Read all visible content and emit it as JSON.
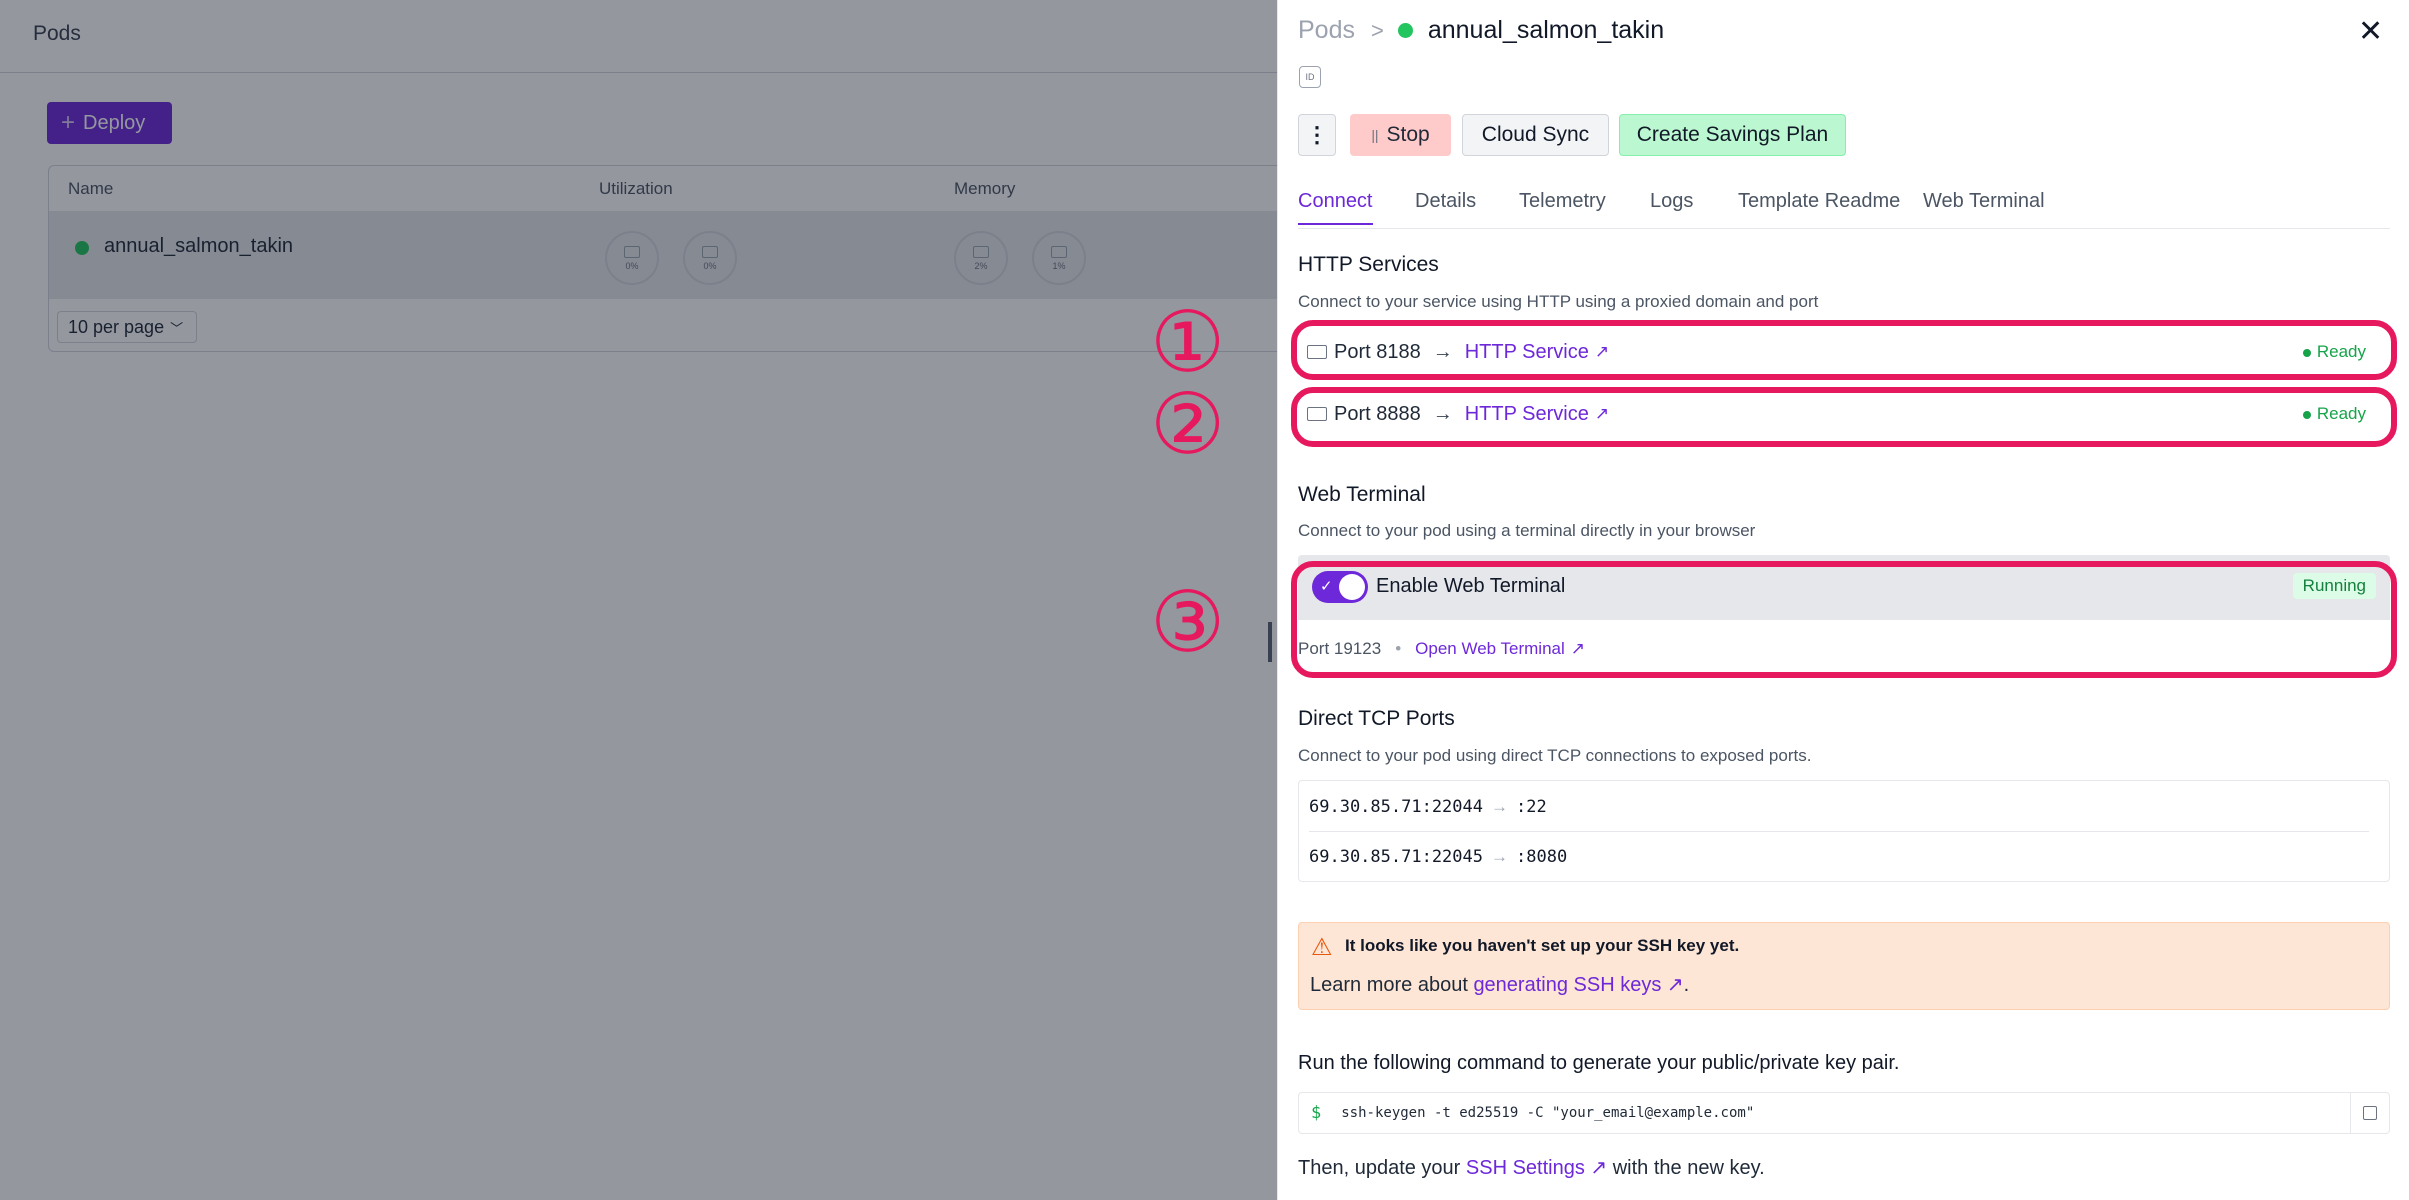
{
  "left": {
    "page_title": "Pods",
    "deploy_label": "Deploy",
    "columns": [
      "Name",
      "Utilization",
      "Memory"
    ],
    "row": {
      "name": "annual_salmon_takin",
      "util": [
        "0%",
        "0%"
      ],
      "mem": [
        "2%",
        "1%"
      ]
    },
    "per_page": "10 per page"
  },
  "panel": {
    "breadcrumb_root": "Pods",
    "breadcrumb_sep": ">",
    "pod_name": "annual_salmon_takin",
    "id_badge": "ID",
    "close": "✕",
    "more": "⋮",
    "stop_label": "Stop",
    "cloud_sync_label": "Cloud Sync",
    "savings_label": "Create Savings Plan",
    "tabs": [
      "Connect",
      "Details",
      "Telemetry",
      "Logs",
      "Template Readme",
      "Web Terminal"
    ],
    "http": {
      "title": "HTTP Services",
      "subtitle": "Connect to your service using HTTP using a proxied domain and port",
      "services": [
        {
          "port": "Port 8188",
          "label": "HTTP Service",
          "status": "Ready"
        },
        {
          "port": "Port 8888",
          "label": "HTTP Service",
          "status": "Ready"
        }
      ]
    },
    "web_terminal": {
      "title": "Web Terminal",
      "subtitle": "Connect to your pod using a terminal directly in your browser",
      "toggle_label": "Enable Web Terminal",
      "status": "Running",
      "port": "Port 19123",
      "open_label": "Open Web Terminal"
    },
    "tcp": {
      "title": "Direct TCP Ports",
      "subtitle": "Connect to your pod using direct TCP connections to exposed ports.",
      "rows": [
        {
          "addr": "69.30.85.71:22044",
          "target": ":22"
        },
        {
          "addr": "69.30.85.71:22045",
          "target": ":8080"
        }
      ]
    },
    "warning": {
      "title": "It looks like you haven't set up your SSH key yet.",
      "prefix": "Learn more about ",
      "link": "generating SSH keys",
      "suffix": "."
    },
    "ssh": {
      "instruction": "Run the following command to generate your public/private key pair.",
      "prompt": "$",
      "command": "ssh-keygen -t ed25519 -C \"your_email@example.com\"",
      "then_prefix": "Then, update your ",
      "then_link": "SSH Settings",
      "then_suffix": " with the new key."
    },
    "annotations": [
      "①",
      "②",
      "③"
    ]
  },
  "colors": {
    "accent": "#6d28d9",
    "highlight": "#e6195e",
    "ready": "#16a34a"
  },
  "icons": [
    "close-icon",
    "more-icon",
    "pause-icon",
    "monitor-icon",
    "arrow-right-icon",
    "external-link-icon",
    "warning-icon",
    "copy-icon",
    "chevron-down-icon",
    "plus-icon",
    "check-icon"
  ]
}
